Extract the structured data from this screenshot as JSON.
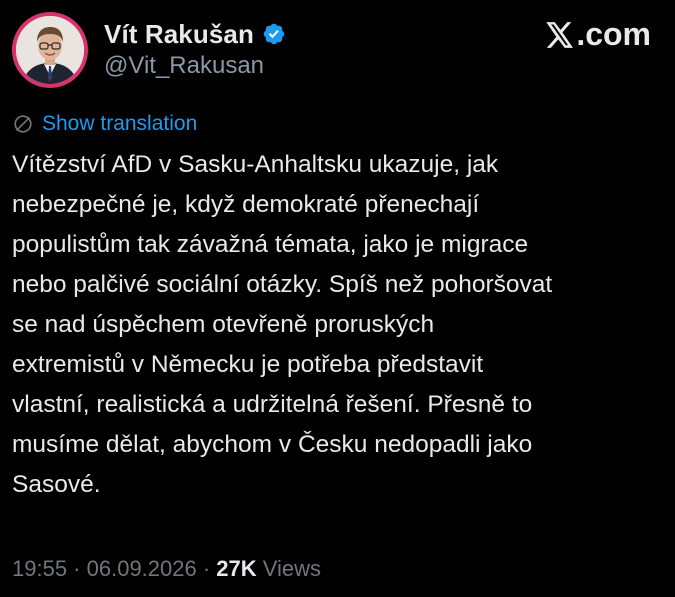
{
  "author": {
    "display_name": "Vít Rakušan",
    "handle": "@Vit_Rakusan",
    "verified_icon": "verified-badge-icon",
    "avatar_ring_color": "#d6336c"
  },
  "brand": {
    "site": ".com",
    "logo_icon": "x-logo-icon"
  },
  "translation": {
    "label": "Show translation",
    "icon": "translate-icon",
    "color": "#1d9bf0"
  },
  "tweet": {
    "text": "Vítězství AfD v Sasku-Anhaltsku ukazuje, jak\nnebezpečné je, když demokraté přenechají\npopulistům tak závažná témata, jako je migrace\nnebo palčivé sociální otázky. Spíš než pohoršovat\nse nad úspěchem otevřeně proruských\nextremistů v Německu je potřeba představit\nvlastní, realistická a udržitelná řešení. Přesně to\nmusíme dělat, abychom v Česku nedopadli jako\nSasové."
  },
  "meta": {
    "time": "19:55",
    "separator": " · ",
    "date": "06.09.2026",
    "views_count": "27K",
    "views_label": " Views"
  }
}
